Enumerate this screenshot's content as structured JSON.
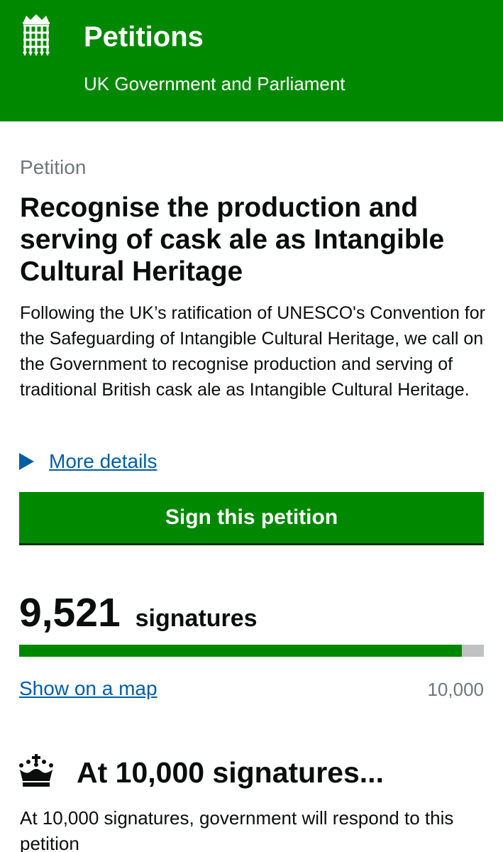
{
  "header": {
    "site_name": "Petitions",
    "site_subtitle": "UK Government and Parliament",
    "logo_icon": "portcullis-icon",
    "background_color": "#008800"
  },
  "petition": {
    "caption": "Petition",
    "title": "Recognise the production and serving of cask ale as Intangible Cultural Heritage",
    "description": "Following the UK’s ratification of UNESCO's Convention for the Safeguarding of Intangible Cultural Heritage, we call on the Government to recognise production and serving of traditional British cask ale as Intangible Cultural Heritage.",
    "more_details_label": "More details",
    "sign_button_label": "Sign this petition"
  },
  "signatures": {
    "count": "9,521",
    "label": "signatures",
    "count_value": 9521,
    "target_value": 10000,
    "target_label": "10,000",
    "map_link_label": "Show on a map"
  },
  "threshold": {
    "icon": "crown-icon",
    "heading": "At 10,000 signatures...",
    "text": "At 10,000 signatures, government will respond to this petition"
  },
  "colors": {
    "brand_green": "#008800",
    "link_blue": "#005ea5",
    "secondary_grey": "#6f777b",
    "progress_track": "#bfc1c3"
  }
}
